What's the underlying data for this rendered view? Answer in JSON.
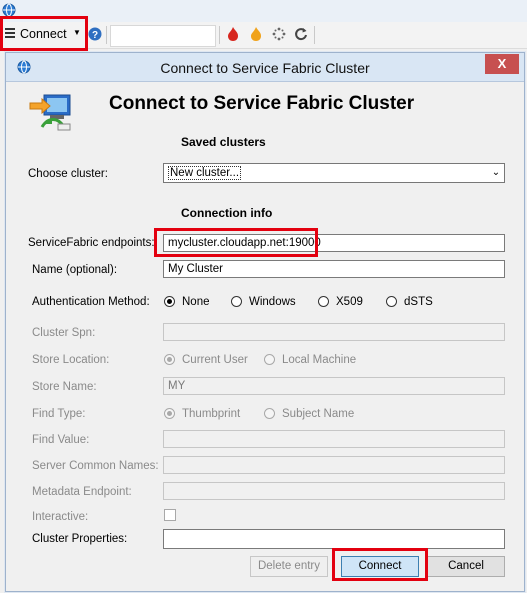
{
  "toolbar": {
    "connect_label": "Connect",
    "icons": [
      "globe-icon",
      "hamburger-icon",
      "dropdown-arrow-icon",
      "help-icon",
      "flame-red-icon",
      "flame-orange-icon",
      "spinner-icon",
      "refresh-icon"
    ]
  },
  "dialog": {
    "title": "Connect to Service Fabric Cluster",
    "heading": "Connect to Service Fabric Cluster",
    "close_label": "X"
  },
  "saved": {
    "section": "Saved clusters",
    "choose_label": "Choose cluster:",
    "choose_value": "New cluster..."
  },
  "conn": {
    "section": "Connection info",
    "endpoints_label": "ServiceFabric endpoints:",
    "endpoints_value": "mycluster.cloudapp.net:19000",
    "name_label": "Name (optional):",
    "name_value": "My Cluster"
  },
  "auth": {
    "label": "Authentication Method:",
    "options": [
      "None",
      "Windows",
      "X509",
      "dSTS"
    ],
    "selected": "None"
  },
  "cert": {
    "spn_label": "Cluster Spn:",
    "store_location_label": "Store Location:",
    "store_location_options": [
      "Current User",
      "Local Machine"
    ],
    "store_location_selected": "Current User",
    "store_name_label": "Store Name:",
    "store_name_value": "MY",
    "find_type_label": "Find Type:",
    "find_type_options": [
      "Thumbprint",
      "Subject Name"
    ],
    "find_type_selected": "Thumbprint",
    "find_value_label": "Find Value:",
    "common_names_label": "Server Common Names:",
    "metadata_label": "Metadata Endpoint:",
    "interactive_label": "Interactive:"
  },
  "props": {
    "label": "Cluster Properties:"
  },
  "buttons": {
    "delete": "Delete entry",
    "connect": "Connect",
    "cancel": "Cancel"
  },
  "colors": {
    "highlight": "#e3000f",
    "titlebar": "#d9e6f4",
    "close": "#c75050",
    "accent": "#cfe5f7"
  }
}
